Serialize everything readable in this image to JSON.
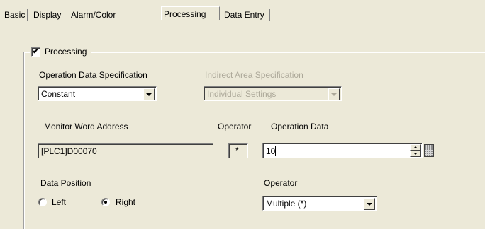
{
  "tabs": [
    {
      "label": "Basic",
      "active": false
    },
    {
      "label": "Display",
      "active": false
    },
    {
      "label": "Alarm/Color",
      "active": false
    },
    {
      "label": "Processing",
      "active": true
    },
    {
      "label": "Data Entry",
      "active": false
    }
  ],
  "processing": {
    "checkbox_label": "Processing",
    "checked": true,
    "check_glyph": "✔"
  },
  "operation_data_spec": {
    "label": "Operation Data Specification",
    "value": "Constant"
  },
  "indirect_area_spec": {
    "label": "Indirect Area Specification",
    "value": "Individual Settings",
    "enabled": false
  },
  "monitor_word_address": {
    "label": "Monitor Word Address",
    "value": "[PLC1]D00070"
  },
  "operator_symbol": {
    "label": "Operator",
    "value": "*"
  },
  "operation_data": {
    "label": "Operation Data",
    "value": "10"
  },
  "data_position": {
    "label": "Data Position",
    "options": [
      {
        "label": "Left",
        "selected": false
      },
      {
        "label": "Right",
        "selected": true
      }
    ]
  },
  "operator_select": {
    "label": "Operator",
    "value": "Multiple (*)"
  },
  "icons": {
    "spin": "spin-up-down-icon",
    "keypad": "keypad-icon",
    "dropdown": "chevron-down-icon"
  },
  "colors": {
    "window_bg": "#ece9d8",
    "disabled_text": "#aca899"
  }
}
